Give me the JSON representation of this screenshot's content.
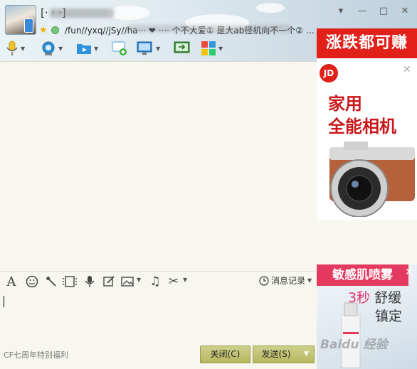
{
  "header": {
    "contact_name": "[· · ·]",
    "signature": "/fun//yxq//jSy//ha··· ❤ ···· 个不大爱① 是大ab径机向不一个② …",
    "window_controls": {
      "dropdown": "▾",
      "minimize": "—",
      "maximize": "□",
      "close": "✕"
    }
  },
  "toolbar": {
    "items": [
      {
        "name": "voice-call",
        "icon": "microphone-icon"
      },
      {
        "name": "video-call",
        "icon": "camera-icon"
      },
      {
        "name": "send-file",
        "icon": "folder-icon"
      },
      {
        "name": "group-chat",
        "icon": "add-chat-icon"
      },
      {
        "name": "remote-desktop",
        "icon": "monitor-icon"
      },
      {
        "name": "screen-share",
        "icon": "share-screen-icon"
      },
      {
        "name": "apps",
        "icon": "apps-icon"
      }
    ]
  },
  "input_toolbar": {
    "items": [
      {
        "name": "font",
        "icon": "font-icon"
      },
      {
        "name": "emoji",
        "icon": "smiley-icon"
      },
      {
        "name": "nudge",
        "icon": "shake-icon"
      },
      {
        "name": "film",
        "icon": "film-icon"
      },
      {
        "name": "voice-message",
        "icon": "mic-icon"
      },
      {
        "name": "doodle",
        "icon": "pen-icon"
      },
      {
        "name": "image",
        "icon": "image-icon"
      },
      {
        "name": "music",
        "icon": "music-icon"
      },
      {
        "name": "screenshot",
        "icon": "scissors-icon"
      }
    ],
    "history_label": "消息记录"
  },
  "footer": {
    "promo_text": "CF七周年特别福利",
    "close_label": "关闭(C)",
    "send_label": "发送(S)"
  },
  "ads": {
    "top": {
      "banner": "涨跌都可赚",
      "logo": "JD",
      "title_line1": "家用",
      "title_line2": "全能相机"
    },
    "bottom": {
      "banner": "敏感肌喷雾",
      "sub_red": "3秒",
      "sub_rest": " 舒缓",
      "sub_line2": "镇定"
    }
  },
  "watermark": "Baidu 经验",
  "colors": {
    "jd_red": "#e1201a",
    "pink_banner": "#e53a5f",
    "button_olive": "#c2c274"
  }
}
